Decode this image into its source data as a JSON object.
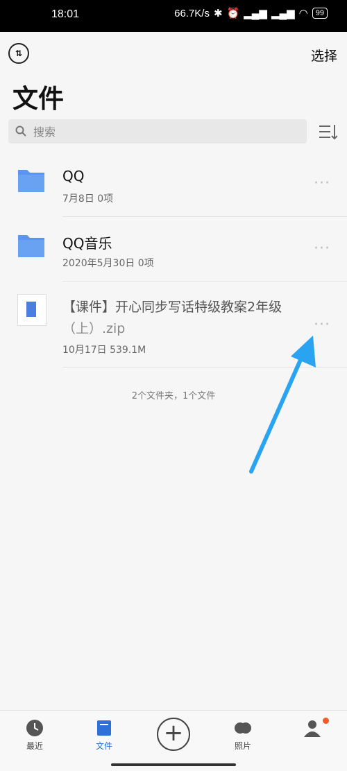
{
  "status_bar": {
    "time": "18:01",
    "speed": "66.7K/s",
    "battery": "99"
  },
  "header": {
    "select_label": "选择",
    "title": "文件"
  },
  "search": {
    "placeholder": "搜索"
  },
  "files": [
    {
      "name": "QQ",
      "meta": "7月8日  0项",
      "type": "folder"
    },
    {
      "name": "QQ音乐",
      "meta": "2020年5月30日  0项",
      "type": "folder"
    },
    {
      "name_line1": "【课件】开心同步写话特级教案2年级",
      "name_line2": "（上）.zip",
      "meta": "10月17日  539.1M",
      "type": "zip"
    }
  ],
  "summary": "2个文件夹，1个文件",
  "nav": {
    "recent": "最近",
    "files": "文件",
    "photos": "照片"
  },
  "colors": {
    "accent": "#2e6fd8",
    "arrow": "#2aa4f0"
  }
}
